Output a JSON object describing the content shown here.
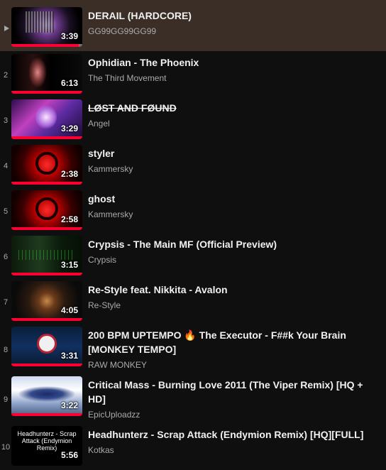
{
  "playlist": {
    "items": [
      {
        "index": "",
        "title": "DERAIL (HARDCORE)",
        "channel": "GG99GG99GG99",
        "duration": "3:39",
        "active": true,
        "progress": 0.95,
        "art": "derail"
      },
      {
        "index": "2",
        "title": "Ophidian - The Phoenix",
        "channel": "The Third Movement",
        "duration": "6:13",
        "progress": 1,
        "art": "ophidian"
      },
      {
        "index": "3",
        "title": "ŁØ𝑆𝑇 ₳ℕĐ FØUND",
        "title_display": "LØST AND FØUND",
        "channel": "Angel",
        "duration": "3:29",
        "progress": 1,
        "art": "lost"
      },
      {
        "index": "4",
        "title": "styler",
        "channel": "Kammersky",
        "duration": "2:38",
        "progress": 1,
        "art": "bio"
      },
      {
        "index": "5",
        "title": "ghost",
        "channel": "Kammersky",
        "duration": "2:58",
        "progress": 1,
        "art": "bio"
      },
      {
        "index": "6",
        "title": "Crypsis - The Main MF (Official Preview)",
        "channel": "Crypsis",
        "duration": "3:15",
        "progress": 1,
        "art": "crypsis"
      },
      {
        "index": "7",
        "title": "Re-Style feat. Nikkita - Avalon",
        "channel": "Re-Style",
        "duration": "4:05",
        "progress": 1,
        "art": "restyle"
      },
      {
        "index": "8",
        "title": "200 BPM UPTEMPO 🔥 The Executor - F##k Your Brain [MONKEY TEMPO]",
        "channel": "RAW MONKEY",
        "duration": "3:31",
        "progress": 1,
        "art": "monkey"
      },
      {
        "index": "9",
        "title": "Critical Mass - Burning Love 2011 (The Viper Remix) [HQ + HD]",
        "channel": "EpicUploadzz",
        "duration": "3:22",
        "progress": 1,
        "art": "critical"
      },
      {
        "index": "10",
        "title": "Headhunterz - Scrap Attack (Endymion Remix) [HQ][FULL]",
        "channel": "Kotkas",
        "duration": "5:56",
        "progress": 0,
        "art": "head",
        "thumb_text": "Headhunterz - Scrap Attack (Endymion Remix)"
      }
    ]
  },
  "colors": {
    "background": "#0f0f0f",
    "active_row": "#3b2e27",
    "progress_fill": "#ff0033",
    "secondary_text": "#aaaaaa"
  }
}
